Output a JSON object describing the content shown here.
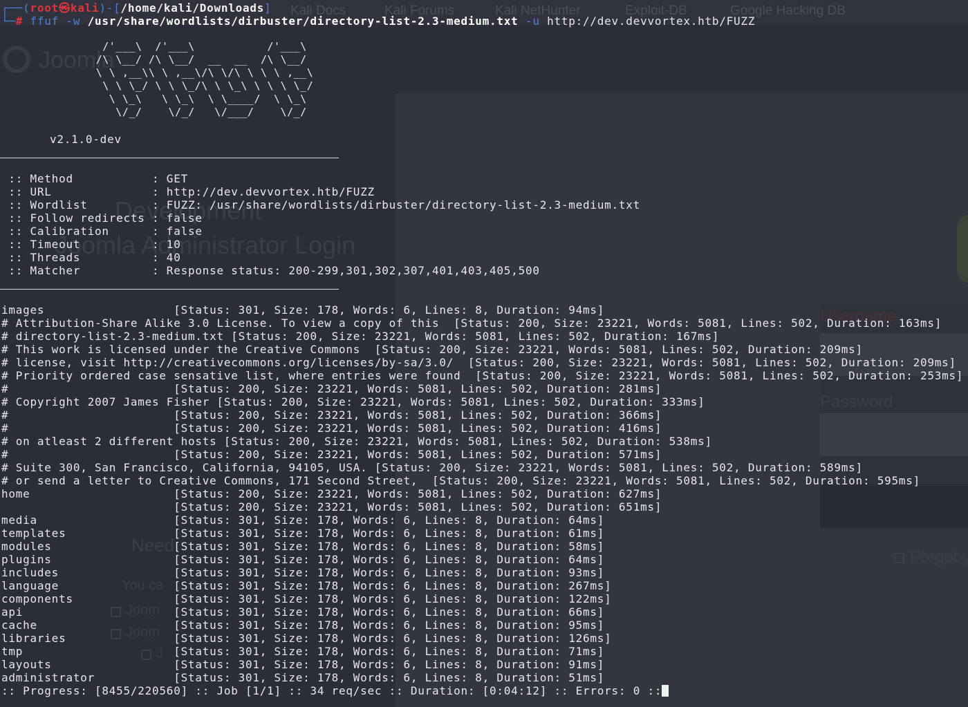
{
  "background": {
    "bookmarks": [
      "Kali Docs",
      "Kali Forums",
      "Kali NetHunter",
      "Exploit-DB",
      "Google Hacking DB"
    ],
    "site_title_fragment": "Joomla",
    "heading_development": "Development",
    "heading_login": "Joomla Administrator Login",
    "label_username": "Username",
    "label_password": "Password",
    "forgot_link": "Forgot y",
    "need_help": "Need",
    "you_can": "You ca",
    "joomla_link_1": "Joom",
    "joomla_link_2": "Joom",
    "joomla_link_3": "J"
  },
  "prompt": {
    "line1_prefix": "┌──(",
    "user": "root",
    "skull": "㉿",
    "host": "kali",
    "line1_mid": ")-[",
    "cwd": "/home/kali/Downloads",
    "line1_suffix": "]",
    "line2_prefix": "└─",
    "hash": "# ",
    "command": "ffuf",
    "opt_w": " -w ",
    "wordlist": "/usr/share/wordlists/dirbuster/directory-list-2.3-medium.txt",
    "opt_u": " -u ",
    "target_url": "http://dev.devvortex.htb/FUZZ"
  },
  "banner_art": "        /'___\\  /'___\\           /'___\\       \n       /\\ \\__/ /\\ \\__/  __  __  /\\ \\__/       \n       \\ \\ ,__\\\\ \\ ,__\\/\\ \\/\\ \\ \\ \\ ,__\\      \n        \\ \\ \\_/ \\ \\ \\_/\\ \\ \\_\\ \\ \\ \\ \\_/      \n         \\ \\_\\   \\ \\_\\  \\ \\____/  \\ \\_\\       \n          \\/_/    \\/_/   \\/___/    \\/_/       ",
  "version": "v2.1.0-dev",
  "config": [
    {
      "key": "Method",
      "value": "GET"
    },
    {
      "key": "URL",
      "value": "http://dev.devvortex.htb/FUZZ"
    },
    {
      "key": "Wordlist",
      "value": "FUZZ: /usr/share/wordlists/dirbuster/directory-list-2.3-medium.txt"
    },
    {
      "key": "Follow redirects",
      "value": "false"
    },
    {
      "key": "Calibration",
      "value": "false"
    },
    {
      "key": "Timeout",
      "value": "10"
    },
    {
      "key": "Threads",
      "value": "40"
    },
    {
      "key": "Matcher",
      "value": "Response status: 200-299,301,302,307,401,403,405,500"
    }
  ],
  "config_lines": [
    " :: Method           : GET",
    " :: URL              : http://dev.devvortex.htb/FUZZ",
    " :: Wordlist         : FUZZ: /usr/share/wordlists/dirbuster/directory-list-2.3-medium.txt",
    " :: Follow redirects : false",
    " :: Calibration      : false",
    " :: Timeout          : 10",
    " :: Threads          : 40",
    " :: Matcher          : Response status: 200-299,301,302,307,401,403,405,500"
  ],
  "results": [
    "images                  [Status: 301, Size: 178, Words: 6, Lines: 8, Duration: 94ms]",
    "# Attribution-Share Alike 3.0 License. To view a copy of this  [Status: 200, Size: 23221, Words: 5081, Lines: 502, Duration: 163ms]",
    "# directory-list-2.3-medium.txt [Status: 200, Size: 23221, Words: 5081, Lines: 502, Duration: 167ms]",
    "# This work is licensed under the Creative Commons  [Status: 200, Size: 23221, Words: 5081, Lines: 502, Duration: 209ms]",
    "# license, visit http://creativecommons.org/licenses/by-sa/3.0/  [Status: 200, Size: 23221, Words: 5081, Lines: 502, Duration: 209ms]",
    "# Priority ordered case sensative list, where entries were found  [Status: 200, Size: 23221, Words: 5081, Lines: 502, Duration: 253ms]",
    "#                       [Status: 200, Size: 23221, Words: 5081, Lines: 502, Duration: 281ms]",
    "# Copyright 2007 James Fisher [Status: 200, Size: 23221, Words: 5081, Lines: 502, Duration: 333ms]",
    "#                       [Status: 200, Size: 23221, Words: 5081, Lines: 502, Duration: 366ms]",
    "#                       [Status: 200, Size: 23221, Words: 5081, Lines: 502, Duration: 416ms]",
    "# on atleast 2 different hosts [Status: 200, Size: 23221, Words: 5081, Lines: 502, Duration: 538ms]",
    "#                       [Status: 200, Size: 23221, Words: 5081, Lines: 502, Duration: 571ms]",
    "# Suite 300, San Francisco, California, 94105, USA. [Status: 200, Size: 23221, Words: 5081, Lines: 502, Duration: 589ms]",
    "# or send a letter to Creative Commons, 171 Second Street,  [Status: 200, Size: 23221, Words: 5081, Lines: 502, Duration: 595ms]",
    "home                    [Status: 200, Size: 23221, Words: 5081, Lines: 502, Duration: 627ms]",
    "                        [Status: 200, Size: 23221, Words: 5081, Lines: 502, Duration: 651ms]",
    "media                   [Status: 301, Size: 178, Words: 6, Lines: 8, Duration: 64ms]",
    "templates               [Status: 301, Size: 178, Words: 6, Lines: 8, Duration: 61ms]",
    "modules                 [Status: 301, Size: 178, Words: 6, Lines: 8, Duration: 58ms]",
    "plugins                 [Status: 301, Size: 178, Words: 6, Lines: 8, Duration: 64ms]",
    "includes                [Status: 301, Size: 178, Words: 6, Lines: 8, Duration: 93ms]",
    "language                [Status: 301, Size: 178, Words: 6, Lines: 8, Duration: 267ms]",
    "components              [Status: 301, Size: 178, Words: 6, Lines: 8, Duration: 122ms]",
    "api                     [Status: 301, Size: 178, Words: 6, Lines: 8, Duration: 66ms]",
    "cache                   [Status: 301, Size: 178, Words: 6, Lines: 8, Duration: 95ms]",
    "libraries               [Status: 301, Size: 178, Words: 6, Lines: 8, Duration: 126ms]",
    "tmp                     [Status: 301, Size: 178, Words: 6, Lines: 8, Duration: 71ms]",
    "layouts                 [Status: 301, Size: 178, Words: 6, Lines: 8, Duration: 91ms]",
    "administrator           [Status: 301, Size: 178, Words: 6, Lines: 8, Duration: 51ms]"
  ],
  "progress_line": ":: Progress: [8455/220560] :: Job [1/1] :: 34 req/sec :: Duration: [0:04:12] :: Errors: 0 ::",
  "progress": {
    "current": 8455,
    "total": 220560,
    "job": "1/1",
    "rate": "34 req/sec",
    "duration": "0:04:12",
    "errors": 0
  },
  "colors": {
    "terminal_bg": "#2b2e38",
    "text": "#e6e8ee",
    "prompt_red": "#e0353c",
    "prompt_blue": "#4a7fd4"
  }
}
